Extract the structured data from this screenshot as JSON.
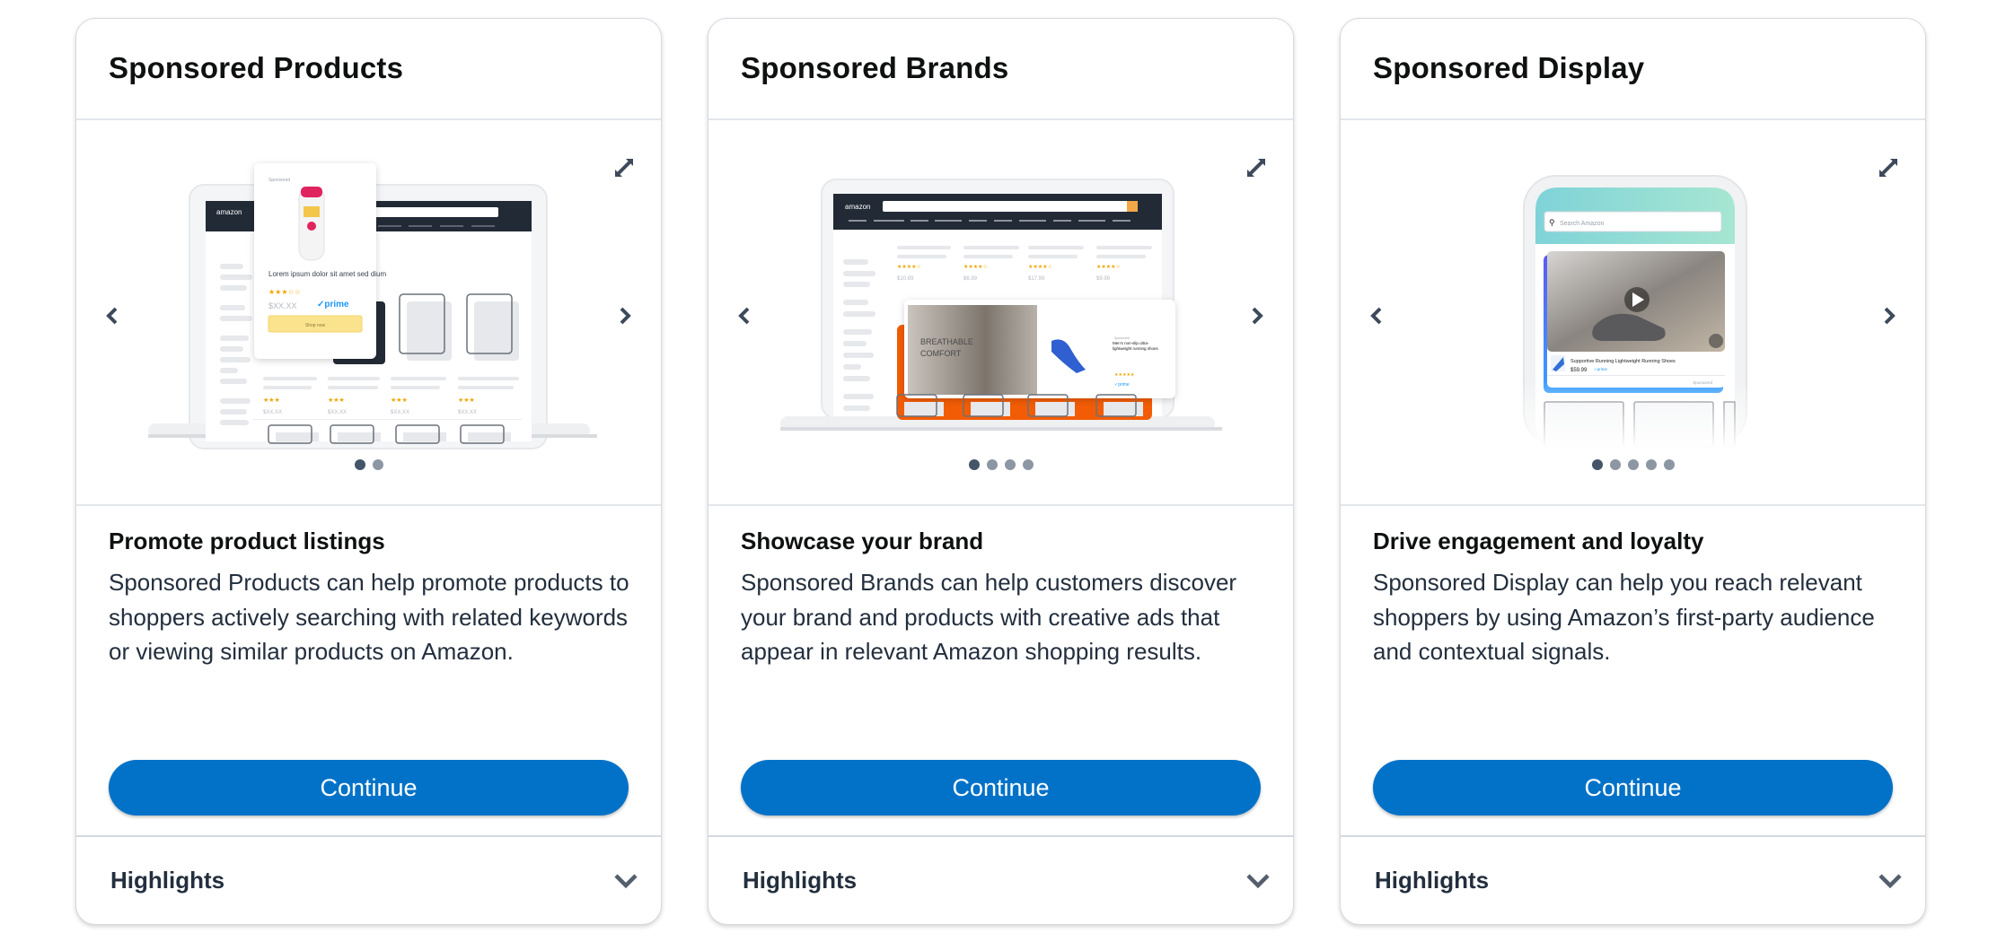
{
  "colors": {
    "primary_button": "#0272c8",
    "heading": "#0f1111",
    "body_text": "#232f3e",
    "dot_active": "#445469",
    "dot_inactive": "#8d96a3",
    "icon": "#3d4a5c"
  },
  "cards": [
    {
      "title": "Sponsored Products",
      "subheading": "Promote product listings",
      "description": "Sponsored Products can help promote products to shoppers actively searching with related keywords or viewing similar products on Amazon.",
      "button_label": "Continue",
      "highlights_label": "Highlights",
      "carousel": {
        "slide_count": 2,
        "active_index": 0,
        "icons": {
          "prev": "chevron-left-icon",
          "next": "chevron-right-icon",
          "expand": "expand-icon"
        },
        "mockup": {
          "brand": "amazon",
          "sponsored_label": "Sponsored",
          "product_title": "Lorem ipsum dolor sit amet sed dium",
          "price": "$XX.XX",
          "prime_label": "prime",
          "shop_button": "Shop now",
          "tile_prices": [
            "$XX.XX",
            "$XX.XX",
            "$XX.XX",
            "$XX.XX"
          ]
        }
      }
    },
    {
      "title": "Sponsored Brands",
      "subheading": "Showcase your brand",
      "description": "Sponsored Brands can help customers discover your brand and products with creative ads that appear in relevant Amazon shopping results.",
      "button_label": "Continue",
      "highlights_label": "Highlights",
      "carousel": {
        "slide_count": 4,
        "active_index": 0,
        "icons": {
          "prev": "chevron-left-icon",
          "next": "chevron-right-icon",
          "expand": "expand-icon"
        },
        "mockup": {
          "brand": "amazon",
          "tile_prices": [
            "$10.89",
            "$6.99",
            "$17.99",
            "$9.99"
          ],
          "banner_text_1": "BREATHABLE",
          "banner_text_2": "COMFORT",
          "sponsored_label": "Sponsored",
          "product_title": "Men's non-slip ultra-lightweight running shoes",
          "prime_label": "prime"
        }
      }
    },
    {
      "title": "Sponsored Display",
      "subheading": "Drive engagement and loyalty",
      "description": "Sponsored Display can help you reach relevant shoppers by using Amazon’s first-party audience and contextual signals.",
      "button_label": "Continue",
      "highlights_label": "Highlights",
      "carousel": {
        "slide_count": 5,
        "active_index": 0,
        "icons": {
          "prev": "chevron-left-icon",
          "next": "chevron-right-icon",
          "expand": "expand-icon"
        },
        "mockup": {
          "search_placeholder": "Search Amazon",
          "product_title": "Supportive Running Lightweight Running Shoes",
          "price": "$59.99",
          "prime_label": "prime",
          "sponsored_label": "Sponsored"
        }
      }
    }
  ]
}
